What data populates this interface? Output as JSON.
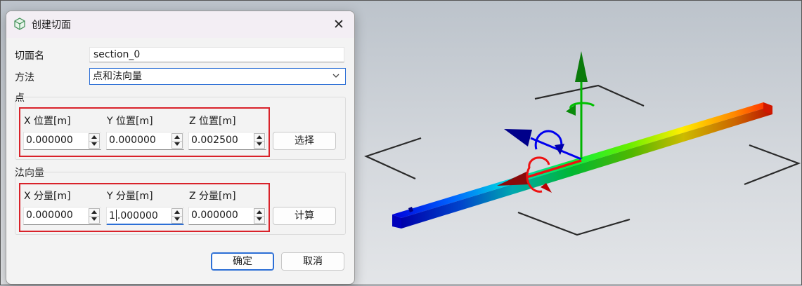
{
  "dialog": {
    "title": "创建切面",
    "close_glyph": "✕",
    "section_name_label": "切面名",
    "section_name_value": "section_0",
    "method_label": "方法",
    "method_value": "点和法向量",
    "point_group": {
      "title": "点",
      "x_label": "X 位置[m]",
      "y_label": "Y 位置[m]",
      "z_label": "Z 位置[m]",
      "x_value": "0.000000",
      "y_value": "0.000000",
      "z_value": "0.002500",
      "select_button": "选择"
    },
    "normal_group": {
      "title": "法向量",
      "x_label": "X 分量[m]",
      "y_label": "Y 分量[m]",
      "z_label": "Z 分量[m]",
      "x_value": "0.000000",
      "y_value_before_caret": "1",
      "y_value_after_caret": ".000000",
      "z_value": "0.000000",
      "compute_button": "计算"
    },
    "ok_button": "确定",
    "cancel_button": "取消"
  },
  "colors": {
    "accent": "#2c6fd6",
    "highlight": "#d9222a",
    "axis_x": "#ee1111",
    "axis_y": "#00b400",
    "axis_z": "#0000ee"
  },
  "icons": [
    "section-cube-icon",
    "close-icon",
    "chevron-down-icon",
    "spin-up-icon",
    "spin-down-icon"
  ]
}
